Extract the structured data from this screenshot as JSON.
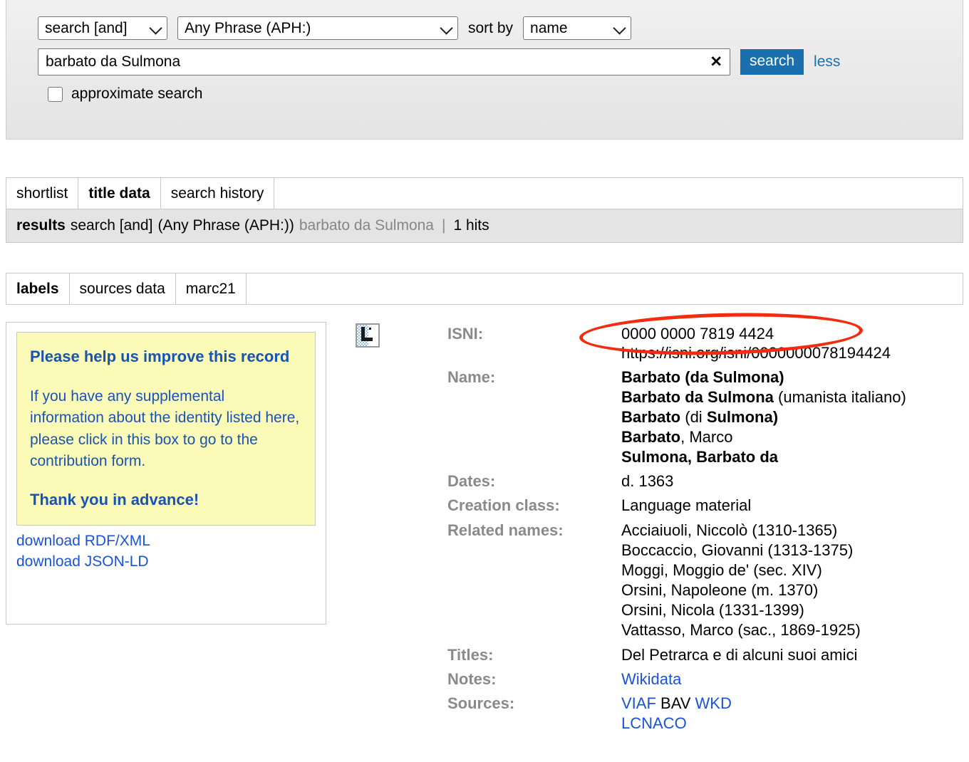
{
  "search": {
    "operator_select": "search [and]",
    "field_select": "Any Phrase (APH:)",
    "sort_by_label": "sort by",
    "sort_select": "name",
    "query_value": "barbato da Sulmona",
    "query_placeholder": "",
    "clear_icon": "x-icon",
    "search_button": "search",
    "less_link": "less",
    "approximate_label": "approximate search",
    "accent_color": "#1a6fae"
  },
  "tabs_primary": [
    {
      "label": "shortlist",
      "active": false
    },
    {
      "label": "title data",
      "active": true
    },
    {
      "label": "search history",
      "active": false
    }
  ],
  "results_bar": {
    "results_label": "results",
    "operator": "search [and]",
    "field": "(Any Phrase (APH:))",
    "query": "barbato da Sulmona",
    "separator": "|",
    "hits": "1 hits"
  },
  "tabs_secondary": [
    {
      "label": "labels",
      "active": true
    },
    {
      "label": "sources data",
      "active": false
    },
    {
      "label": "marc21",
      "active": false
    }
  ],
  "help_box": {
    "heading": "Please help us improve this record",
    "body": "If you have any supplemental information about the identity listed here, please click in this box to go to the contribution form.",
    "thanks": "Thank you in advance!",
    "background": "#fbfbb7",
    "text_color": "#1953b4"
  },
  "downloads": [
    {
      "label": "download RDF/XML"
    },
    {
      "label": "download JSON-LD"
    }
  ],
  "record_icon": "identity-thumbnail-icon",
  "record": {
    "isni": {
      "label": "ISNI:",
      "number": "0000 0000 7819 4424",
      "url": "https://isni.org/isni/0000000078194424"
    },
    "name": {
      "label": "Name:",
      "values": [
        [
          {
            "t": "Barbato (da Sulmona)",
            "bold": true
          }
        ],
        [
          {
            "t": "Barbato da Sulmona",
            "bold": true
          },
          {
            "t": " (umanista italiano)",
            "bold": false
          }
        ],
        [
          {
            "t": "Barbato",
            "bold": true
          },
          {
            "t": " (di ",
            "bold": false
          },
          {
            "t": "Sulmona)",
            "bold": true
          }
        ],
        [
          {
            "t": "Barbato",
            "bold": true
          },
          {
            "t": ", Marco",
            "bold": false
          }
        ],
        [
          {
            "t": "Sulmona, Barbato da",
            "bold": true
          }
        ]
      ]
    },
    "dates": {
      "label": "Dates:",
      "value": "d. 1363"
    },
    "creation_class": {
      "label": "Creation class:",
      "value": "Language material"
    },
    "related_names": {
      "label": "Related names:",
      "values": [
        "Acciaiuoli, Niccolò (1310-1365)",
        "Boccaccio, Giovanni (1313-1375)",
        "Moggi, Moggio de' (sec. XIV)",
        "Orsini, Napoleone (m. 1370)",
        "Orsini, Nicola (1331-1399)",
        "Vattasso, Marco (sac., 1869-1925)"
      ]
    },
    "titles": {
      "label": "Titles:",
      "value": "Del Petrarca e di alcuni suoi amici"
    },
    "notes": {
      "label": "Notes:",
      "values": [
        {
          "t": "Wikidata",
          "link": true
        }
      ]
    },
    "sources": {
      "label": "Sources:",
      "line1": [
        {
          "t": "VIAF",
          "link": true
        },
        {
          "t": "BAV",
          "link": false
        },
        {
          "t": "WKD",
          "link": true
        }
      ],
      "line2": [
        {
          "t": "LCNACO",
          "link": true
        }
      ]
    }
  },
  "annotation": {
    "shape": "ellipse",
    "color": "#f32c10",
    "targets": "isni-number"
  }
}
